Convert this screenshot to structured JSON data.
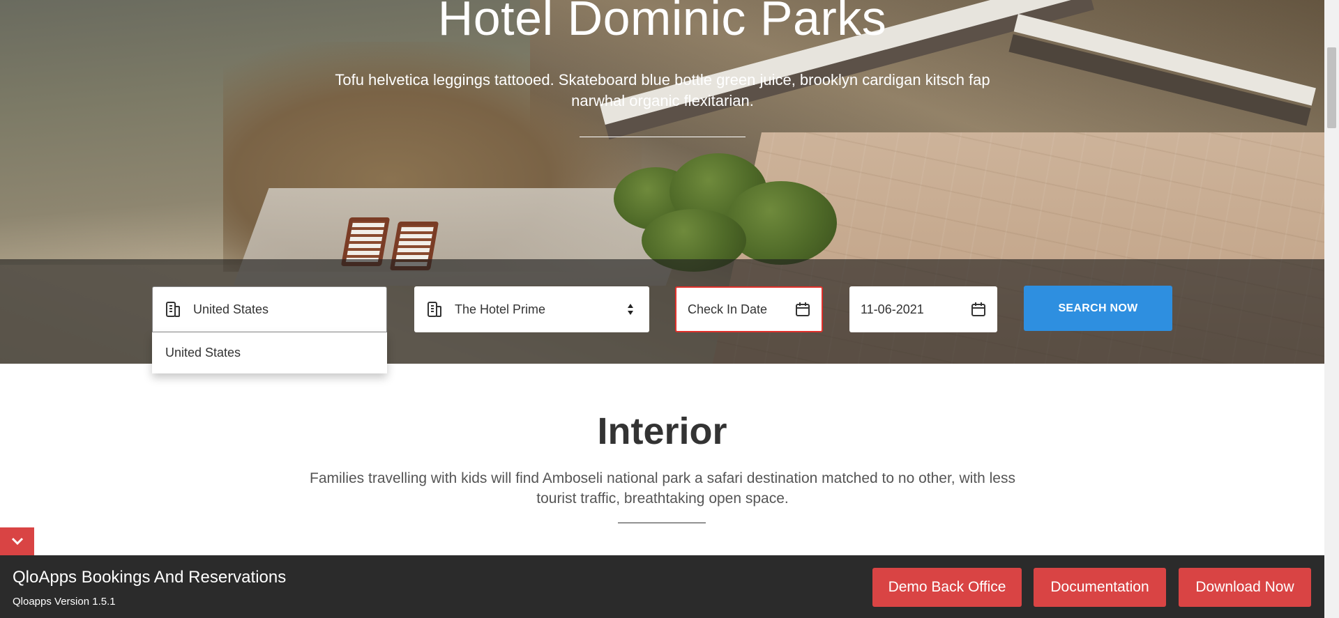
{
  "hero": {
    "title": "Hotel Dominic Parks",
    "subtitle": "Tofu helvetica leggings tattooed. Skateboard blue bottle green juice, brooklyn cardigan kitsch fap narwhal organic flexitarian."
  },
  "search": {
    "location": {
      "value": "United States",
      "icon": "building-icon"
    },
    "location_dropdown": {
      "options": [
        "United States"
      ]
    },
    "hotel": {
      "value": "The Hotel Prime",
      "icon": "building-icon",
      "arrow_icon": "sort-arrows-icon"
    },
    "check_in": {
      "placeholder": "Check In Date",
      "icon": "calendar-icon"
    },
    "check_out": {
      "value": "11-06-2021",
      "icon": "calendar-icon"
    },
    "button_label": "SEARCH NOW"
  },
  "interior": {
    "title": "Interior",
    "description": "Families travelling with kids will find Amboseli national park a safari destination matched to no other, with less tourist traffic, breathtaking open space."
  },
  "footer": {
    "title": "QloApps Bookings And Reservations",
    "version": "Qloapps Version 1.5.1",
    "buttons": [
      "Demo Back Office",
      "Documentation",
      "Download Now"
    ],
    "collapse_icon": "chevron-down-icon"
  },
  "colors": {
    "accent_red": "#d94444",
    "search_blue": "#2e8fe0",
    "error_border": "#e0312b",
    "footer_bg": "#2b2b2b"
  }
}
